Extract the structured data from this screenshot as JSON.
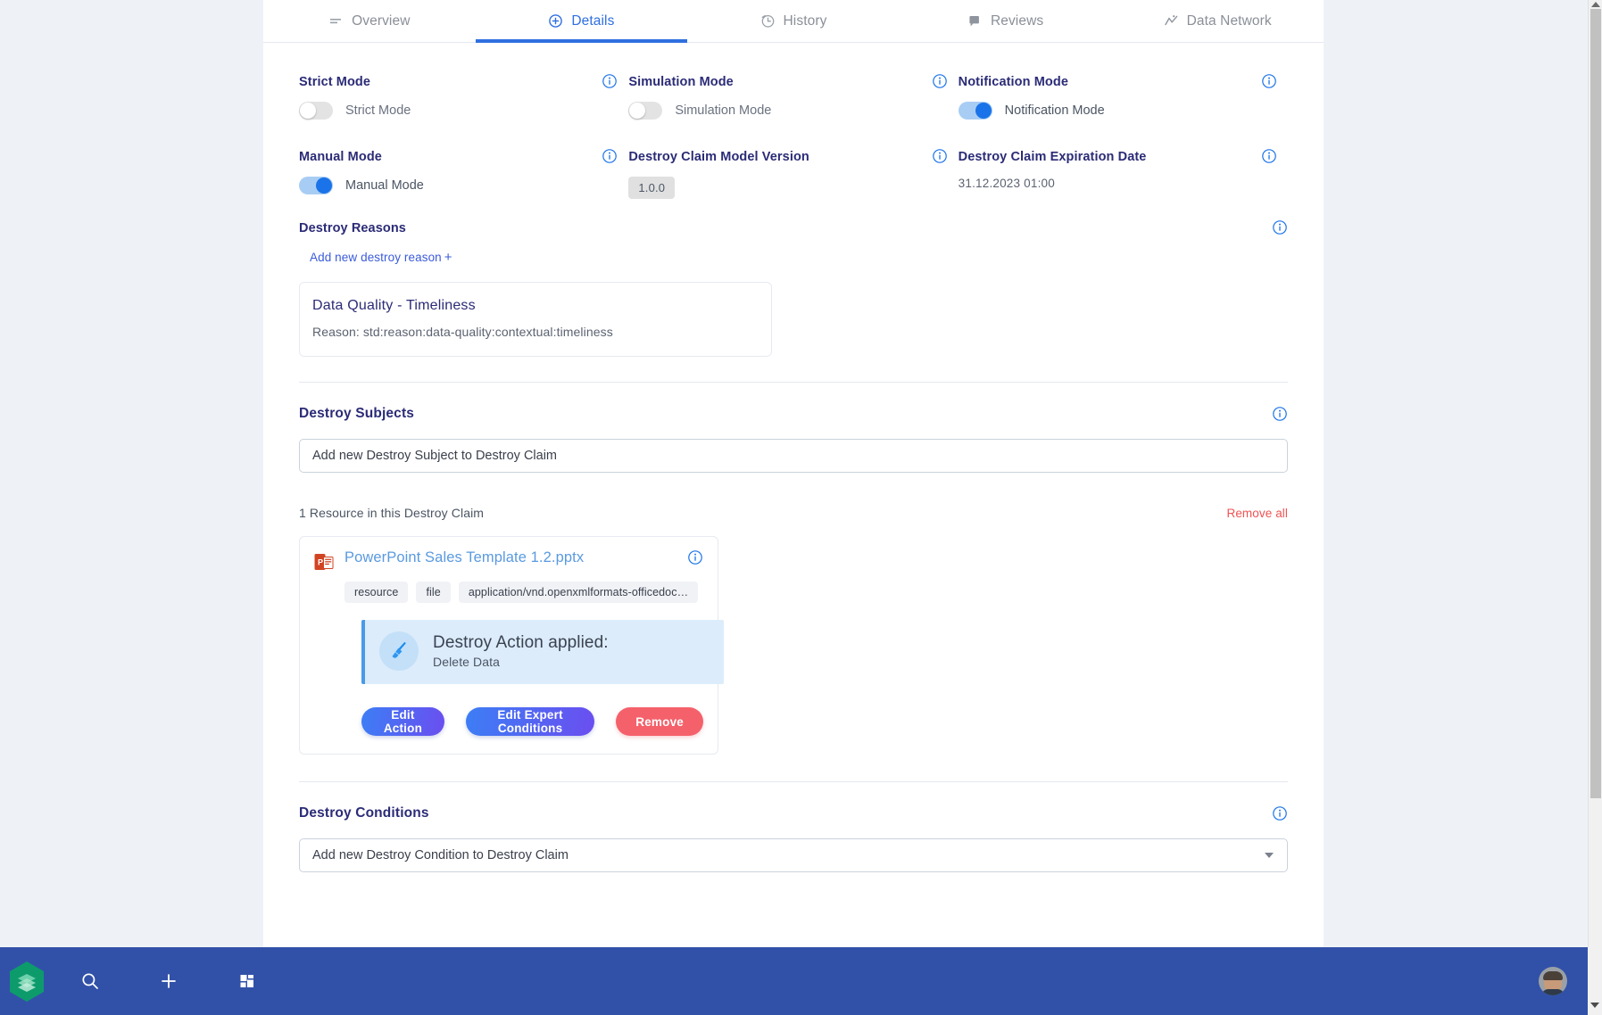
{
  "tabs": [
    {
      "label": "Overview",
      "icon": "list-icon",
      "active": false
    },
    {
      "label": "Details",
      "icon": "plus-circle-icon",
      "active": true
    },
    {
      "label": "History",
      "icon": "clock-icon",
      "active": false
    },
    {
      "label": "Reviews",
      "icon": "comment-icon",
      "active": false
    },
    {
      "label": "Data Network",
      "icon": "trend-line-icon",
      "active": false
    }
  ],
  "settings": [
    {
      "label": "Strict Mode",
      "type": "toggle",
      "toggle_label": "Strict Mode",
      "on": false
    },
    {
      "label": "Simulation Mode",
      "type": "toggle",
      "toggle_label": "Simulation Mode",
      "on": false
    },
    {
      "label": "Notification Mode",
      "type": "toggle",
      "toggle_label": "Notification Mode",
      "on": true
    },
    {
      "label": "Manual Mode",
      "type": "toggle",
      "toggle_label": "Manual Mode",
      "on": true
    },
    {
      "label": "Destroy Claim Model Version",
      "type": "chip",
      "value": "1.0.0"
    },
    {
      "label": "Destroy Claim Expiration Date",
      "type": "text",
      "value": "31.12.2023 01:00"
    }
  ],
  "destroy_reasons": {
    "section_label": "Destroy Reasons",
    "add_link": "Add new destroy reason",
    "add_plus": "+",
    "cards": [
      {
        "title": "Data Quality - Timeliness",
        "subtitle": "Reason: std:reason:data-quality:contextual:timeliness"
      }
    ]
  },
  "destroy_subjects": {
    "title": "Destroy Subjects",
    "input_placeholder": "Add new Destroy Subject to Destroy Claim",
    "input_value": "",
    "count_text": "1 Resource in this Destroy Claim",
    "remove_all_label": "Remove all",
    "resource": {
      "name": "PowerPoint Sales Template 1.2.pptx",
      "tags": [
        "resource",
        "file",
        "application/vnd.openxmlformats-officedoc…"
      ],
      "action_title": "Destroy Action applied:",
      "action_subtitle": "Delete Data",
      "buttons": [
        {
          "label": "Edit Action",
          "style": "gradient"
        },
        {
          "label": "Edit Expert Conditions",
          "style": "gradient"
        },
        {
          "label": "Remove",
          "style": "red"
        }
      ]
    }
  },
  "destroy_conditions": {
    "title": "Destroy Conditions",
    "select_placeholder": "Add new Destroy Condition to Destroy Claim"
  },
  "dock": {
    "logo": "hexagon-stack-logo",
    "icons": [
      "search-icon",
      "plus-icon",
      "apps-grid-icon"
    ],
    "avatar": "user-avatar"
  },
  "colors": {
    "accent_blue": "#2f6fe0",
    "heading_navy": "#2b2b77",
    "danger_red": "#f05252",
    "dock_blue": "#3151a8",
    "logo_green": "#14976b"
  }
}
